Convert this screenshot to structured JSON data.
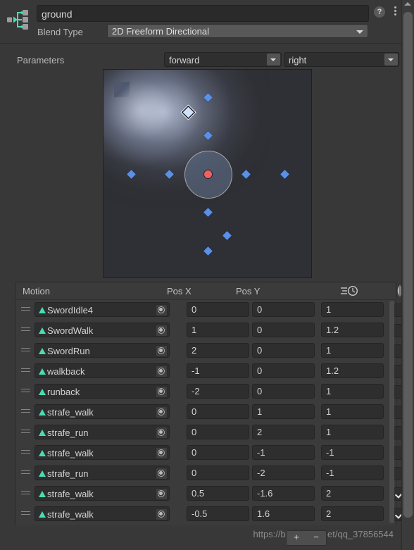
{
  "window": {
    "title": "ground",
    "blend_type_label": "Blend Type",
    "blend_type_value": "2D Freeform Directional",
    "help_icon": "help-circle-icon",
    "menu_icon": "kebab-menu-icon",
    "node_icon": "blend-tree-node-icon"
  },
  "parameters": {
    "label": "Parameters",
    "x_param": "forward",
    "y_param": "right"
  },
  "graph": {
    "name": "blend-graph",
    "red_dot_label": "blend-position-marker",
    "selected_marker": "selected-motion-marker",
    "points": [
      {
        "x": 0,
        "y": 0,
        "selected": false
      },
      {
        "x": 1,
        "y": 0,
        "selected": false
      },
      {
        "x": 2,
        "y": 0,
        "selected": false
      },
      {
        "x": -1,
        "y": 0,
        "selected": false
      },
      {
        "x": -2,
        "y": 0,
        "selected": false
      },
      {
        "x": 0,
        "y": 1,
        "selected": false
      },
      {
        "x": 0,
        "y": 2,
        "selected": false
      },
      {
        "x": 0,
        "y": -1,
        "selected": false
      },
      {
        "x": 0,
        "y": -2,
        "selected": false
      },
      {
        "x": 0.5,
        "y": -1.6,
        "selected": false
      },
      {
        "x": -0.5,
        "y": 1.6,
        "selected": true
      }
    ]
  },
  "table": {
    "headers": {
      "motion": "Motion",
      "pos_x": "Pos X",
      "pos_y": "Pos Y",
      "speed_icon": "timescale-clock-icon",
      "mirror_icon": "mirror-icon"
    },
    "rows": [
      {
        "motion": "SwordIdle4",
        "pos_x": "0",
        "pos_y": "0",
        "speed": "1",
        "mirror": false
      },
      {
        "motion": "SwordWalk",
        "pos_x": "1",
        "pos_y": "0",
        "speed": "1.2",
        "mirror": false
      },
      {
        "motion": "SwordRun",
        "pos_x": "2",
        "pos_y": "0",
        "speed": "1",
        "mirror": false
      },
      {
        "motion": "walkback",
        "pos_x": "-1",
        "pos_y": "0",
        "speed": "1.2",
        "mirror": false
      },
      {
        "motion": "runback",
        "pos_x": "-2",
        "pos_y": "0",
        "speed": "1",
        "mirror": false
      },
      {
        "motion": "strafe_walk",
        "pos_x": "0",
        "pos_y": "1",
        "speed": "1",
        "mirror": false
      },
      {
        "motion": "strafe_run",
        "pos_x": "0",
        "pos_y": "2",
        "speed": "1",
        "mirror": false
      },
      {
        "motion": "strafe_walk",
        "pos_x": "0",
        "pos_y": "-1",
        "speed": "-1",
        "mirror": false
      },
      {
        "motion": "strafe_run",
        "pos_x": "0",
        "pos_y": "-2",
        "speed": "-1",
        "mirror": false
      },
      {
        "motion": "strafe_walk",
        "pos_x": "0.5",
        "pos_y": "-1.6",
        "speed": "2",
        "mirror": true
      },
      {
        "motion": "strafe_walk",
        "pos_x": "-0.5",
        "pos_y": "1.6",
        "speed": "2",
        "mirror": true
      }
    ]
  },
  "footer": {
    "watermark": "https://blog.csdn.net/qq_37856544",
    "add_label": "+",
    "remove_label": "−"
  },
  "colors": {
    "accent_clip": "#4adcb4",
    "marker": "#5b90e8",
    "blend_dot": "#f2615f",
    "panel_bg": "#383838",
    "field_bg": "#2e2e2e"
  }
}
